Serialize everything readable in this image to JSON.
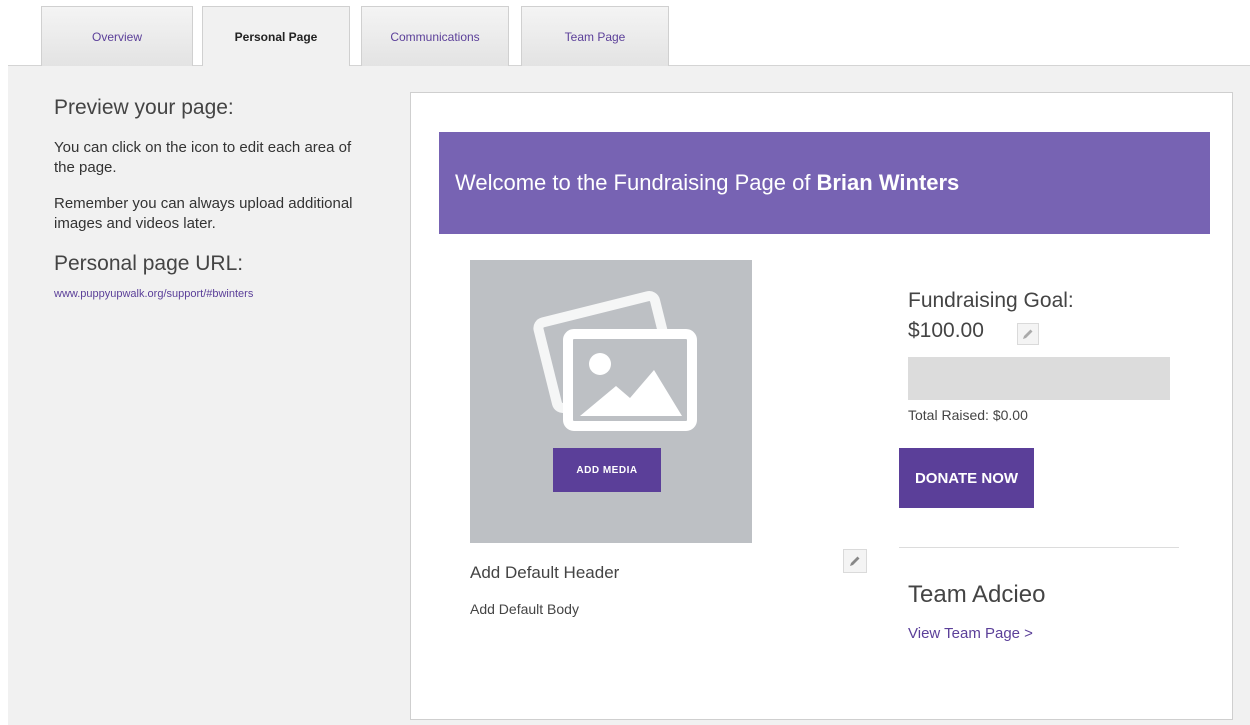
{
  "tabs": [
    {
      "label": "Overview"
    },
    {
      "label": "Personal Page"
    },
    {
      "label": "Communications"
    },
    {
      "label": "Team Page"
    }
  ],
  "sidebar": {
    "heading": "Preview your page:",
    "paragraph1": "You can click on the icon to edit each area of the page.",
    "paragraph2": "Remember you can always upload additional images and videos later.",
    "url_heading": "Personal page URL:",
    "url": "www.puppyupwalk.org/support/#bwinters"
  },
  "preview": {
    "banner_text": "Welcome to the Fundraising Page of",
    "banner_name": "Brian Winters",
    "add_media_label": "ADD MEDIA",
    "default_header": "Add Default Header",
    "default_body": "Add Default Body",
    "goal_label": "Fundraising Goal:",
    "goal_amount": "$100.00",
    "progress_fraction": 0,
    "total_raised": "Total Raised: $0.00",
    "donate_label": "DONATE NOW",
    "team_name": "Team Adcieo",
    "team_link": "View Team Page >"
  },
  "colors": {
    "brand_purple": "#5b3f99",
    "banner_purple": "#7763b3",
    "media_gray": "#bdc0c4"
  },
  "icons": {
    "media_placeholder": "image-placeholder-icon",
    "edit": "pencil-icon"
  }
}
